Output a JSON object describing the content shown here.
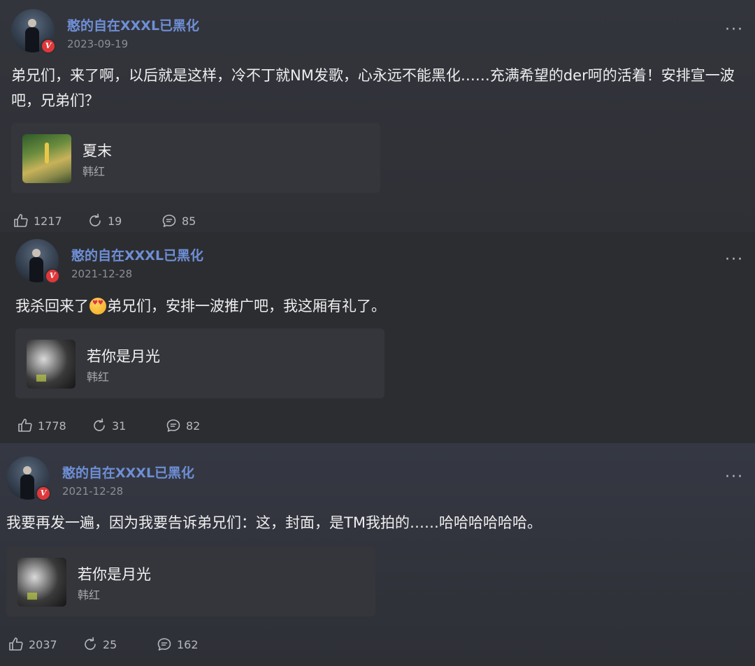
{
  "posts": [
    {
      "username": "憨的自在XXXL已黑化",
      "date": "2023-09-19",
      "more": "···",
      "content_before_emoji": "弟兄们，来了啊，以后就是这样，冷不丁就NM发歌，心永远不能黑化……充满希望的der呵的活着！安排宣一波吧，兄弟们？",
      "content_after_emoji": "",
      "emoji": "",
      "song": {
        "title": "夏末",
        "artist": "韩红",
        "cover": "summer"
      },
      "likes": "1217",
      "reposts": "19",
      "comments": "85"
    },
    {
      "username": "憨的自在XXXL已黑化",
      "date": "2021-12-28",
      "more": "···",
      "content_before_emoji": "我杀回来了",
      "content_after_emoji": "弟兄们，安排一波推广吧，我这厢有礼了。",
      "emoji": "heart-eyes-emoji",
      "song": {
        "title": "若你是月光",
        "artist": "韩红",
        "cover": "moon"
      },
      "likes": "1778",
      "reposts": "31",
      "comments": "82"
    },
    {
      "username": "憨的自在XXXL已黑化",
      "date": "2021-12-28",
      "more": "···",
      "content_before_emoji": "我要再发一遍，因为我要告诉弟兄们：这，封面，是TM我拍的……哈哈哈哈哈哈。",
      "content_after_emoji": "",
      "emoji": "",
      "song": {
        "title": "若你是月光",
        "artist": "韩红",
        "cover": "moon"
      },
      "likes": "2037",
      "reposts": "25",
      "comments": "162"
    }
  ],
  "colors": {
    "username": "#6e8fd6",
    "verified_badge": "#e0383a",
    "background": "#2a2b30",
    "card": "#35363b"
  },
  "icons": {
    "like": "thumbs-up-icon",
    "repost": "repost-icon",
    "comment": "comment-icon",
    "more": "more-dots-icon",
    "verified": "verified-badge-icon"
  }
}
